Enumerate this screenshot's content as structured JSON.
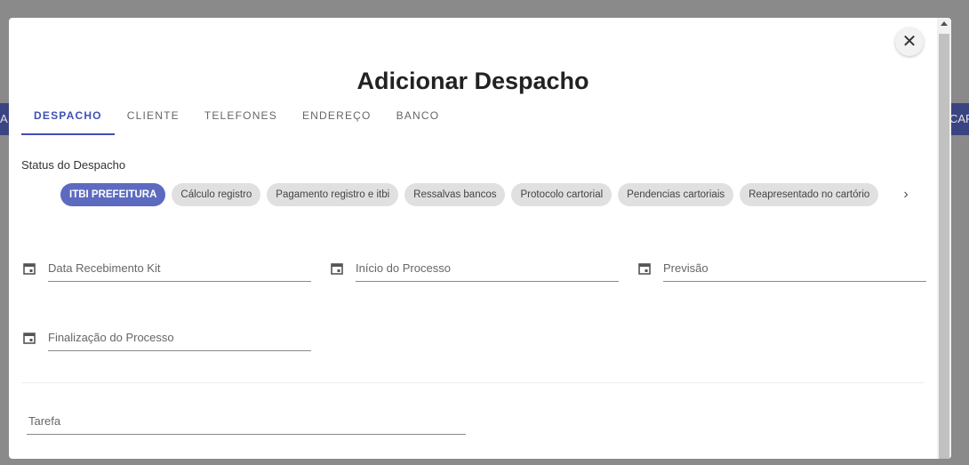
{
  "background": {
    "left_bar_text": "A",
    "right_bar_text": "CAR"
  },
  "modal": {
    "title": "Adicionar Despacho",
    "close_glyph": "✕",
    "tabs": [
      {
        "label": "DESPACHO",
        "active": true
      },
      {
        "label": "CLIENTE",
        "active": false
      },
      {
        "label": "TELEFONES",
        "active": false
      },
      {
        "label": "ENDEREÇO",
        "active": false
      },
      {
        "label": "BANCO",
        "active": false
      }
    ],
    "status_label": "Status do Despacho",
    "status_chips": [
      {
        "label": "ITBI PREFEITURA",
        "active": true
      },
      {
        "label": "Cálculo registro",
        "active": false
      },
      {
        "label": "Pagamento registro e itbi",
        "active": false
      },
      {
        "label": "Ressalvas bancos",
        "active": false
      },
      {
        "label": "Protocolo cartorial",
        "active": false
      },
      {
        "label": "Pendencias cartoriais",
        "active": false
      },
      {
        "label": "Reapresentado no cartório",
        "active": false
      }
    ],
    "chips_next_glyph": "›",
    "date_fields": [
      {
        "label": "Data Recebimento Kit",
        "icon": "calendar-icon"
      },
      {
        "label": "Início do Processo",
        "icon": "calendar-icon"
      },
      {
        "label": "Previsão",
        "icon": "calendar-icon"
      },
      {
        "label": "Finalização do Processo",
        "icon": "calendar-icon"
      }
    ],
    "tarefa_label": "Tarefa"
  },
  "colors": {
    "accent": "#3f51b5",
    "active_chip": "#5c6bc0",
    "chip": "#e0e0e0",
    "backdrop": "#8a8a8a"
  }
}
